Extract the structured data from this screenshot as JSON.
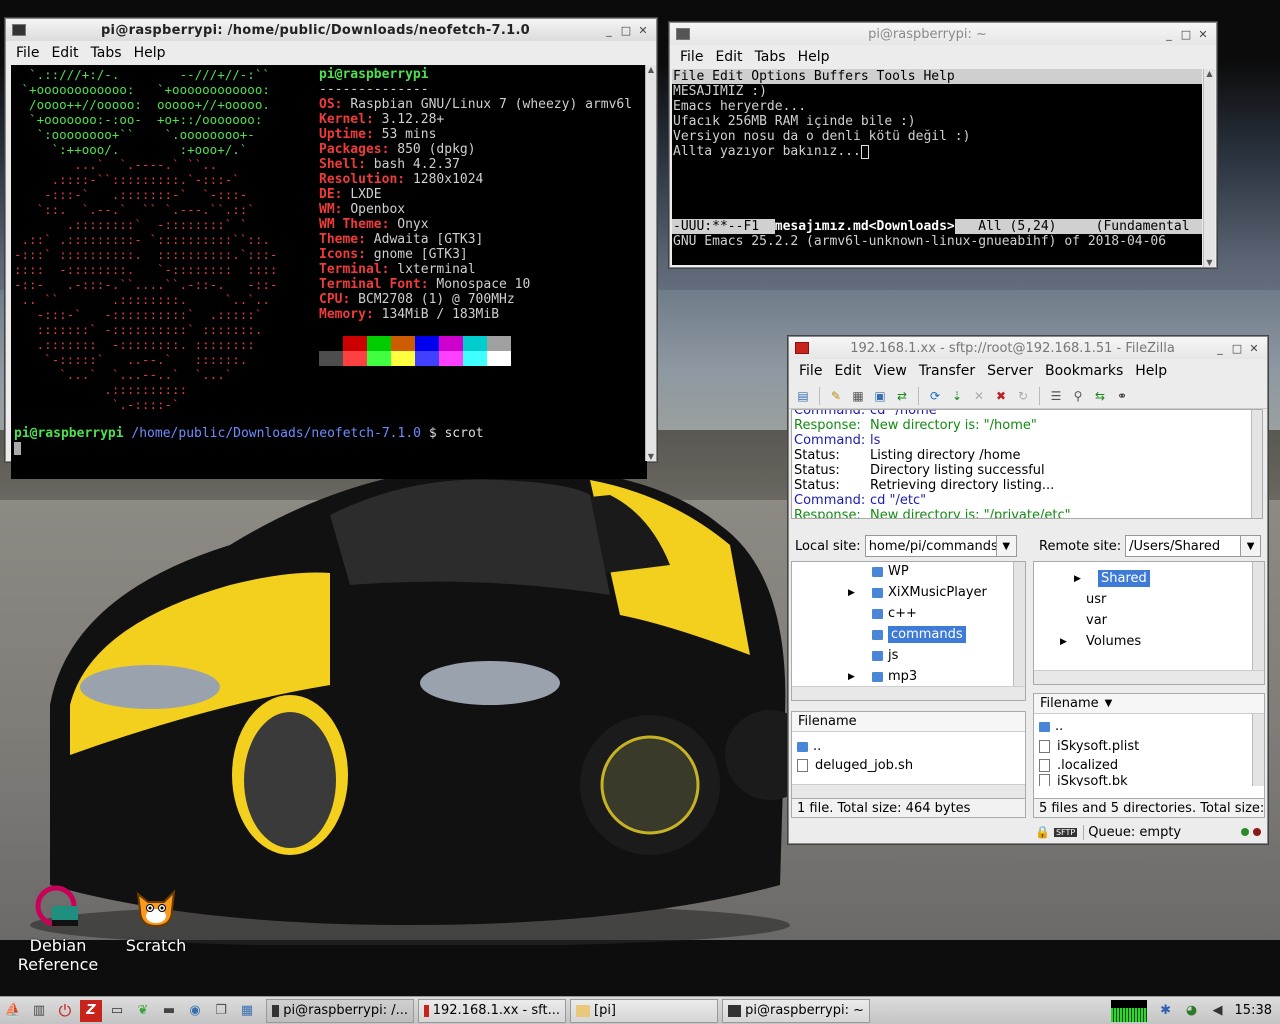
{
  "terminal1": {
    "title": "pi@raspberrypi: /home/public/Downloads/neofetch-7.1.0",
    "menu": [
      "File",
      "Edit",
      "Tabs",
      "Help"
    ],
    "host": "pi@raspberrypi",
    "separator": "--------------",
    "info": [
      {
        "k": "OS",
        "v": "Raspbian GNU/Linux 7 (wheezy) armv6l"
      },
      {
        "k": "Kernel",
        "v": "3.12.28+"
      },
      {
        "k": "Uptime",
        "v": "53 mins"
      },
      {
        "k": "Packages",
        "v": "850 (dpkg)"
      },
      {
        "k": "Shell",
        "v": "bash 4.2.37"
      },
      {
        "k": "Resolution",
        "v": "1280x1024"
      },
      {
        "k": "DE",
        "v": "LXDE"
      },
      {
        "k": "WM",
        "v": "Openbox"
      },
      {
        "k": "WM Theme",
        "v": "Onyx"
      },
      {
        "k": "Theme",
        "v": "Adwaita [GTK3]"
      },
      {
        "k": "Icons",
        "v": "gnome [GTK3]"
      },
      {
        "k": "Terminal",
        "v": "lxterminal"
      },
      {
        "k": "Terminal Font",
        "v": "Monospace 10"
      },
      {
        "k": "CPU",
        "v": "BCM2708 (1) @ 700MHz"
      },
      {
        "k": "Memory",
        "v": "134MiB / 183MiB"
      }
    ],
    "palette_top": [
      "#000000",
      "#cd0000",
      "#00cd00",
      "#cd5c00",
      "#0000ee",
      "#cd00cd",
      "#00cdcd",
      "#a0a0a0"
    ],
    "palette_bottom": [
      "#4d4d4d",
      "#ff4040",
      "#40ff40",
      "#ffff40",
      "#4040ff",
      "#ff40ff",
      "#40ffff",
      "#ffffff"
    ],
    "prompt_user": "pi@raspberrypi",
    "prompt_path": "/home/public/Downloads/neofetch-7.1.0",
    "prompt_cmd": "$ scrot"
  },
  "terminal2": {
    "title": "pi@raspberrypi: ~",
    "menu": [
      "File",
      "Edit",
      "Tabs",
      "Help"
    ],
    "emacs_menu": "File Edit Options Buffers Tools Help",
    "lines": [
      "MESAJIMIZ :)",
      "Emacs heryerde...",
      "Ufacık 256MB RAM içinde bile :)",
      "Versiyon nosu da o denli kötü değil :)",
      "Allta yazıyor bakınız..."
    ],
    "modeline_left": "-UUU:**--F1  ",
    "modeline_buffer": "mesajımız.md<Downloads>",
    "modeline_right": "   All (5,24)     (Fundamental",
    "minibuffer": "GNU Emacs 25.2.2 (armv6l-unknown-linux-gnueabihf) of 2018-04-06"
  },
  "filezilla": {
    "title": "192.168.1.xx - sftp://root@192.168.1.51 - FileZilla",
    "menu": [
      "File",
      "Edit",
      "View",
      "Transfer",
      "Server",
      "Bookmarks",
      "Help"
    ],
    "log": [
      {
        "label": "Command:",
        "text": "cd \"/home\"",
        "kind": "cm"
      },
      {
        "label": "Response:",
        "text": "New directory is: \"/home\"",
        "kind": "rs"
      },
      {
        "label": "Command:",
        "text": "ls",
        "kind": "cm"
      },
      {
        "label": "Status:",
        "text": "Listing directory /home",
        "kind": "st"
      },
      {
        "label": "Status:",
        "text": "Directory listing successful",
        "kind": "st"
      },
      {
        "label": "Status:",
        "text": "Retrieving directory listing...",
        "kind": "st"
      },
      {
        "label": "Command:",
        "text": "cd \"/etc\"",
        "kind": "cm"
      },
      {
        "label": "Response:",
        "text": "New directory is: \"/private/etc\"",
        "kind": "rs"
      }
    ],
    "local_label": "Local site:",
    "local_path": "home/pi/commands/",
    "remote_label": "Remote site:",
    "remote_path": "/Users/Shared",
    "local_tree": [
      "WP",
      "XiXMusicPlayer",
      "c++",
      "commands",
      "js",
      "mp3"
    ],
    "remote_tree": [
      "Shared",
      "usr",
      "var",
      "Volumes"
    ],
    "filename_header": "Filename",
    "local_files": [
      "..",
      "deluged_job.sh"
    ],
    "remote_files": [
      "..",
      "iSkysoft.plist",
      ".localized",
      "iSkysoft.bk"
    ],
    "local_status": "1 file. Total size: 464 bytes",
    "remote_status": "5 files and 5 directories. Total size:",
    "queue": "Queue: empty"
  },
  "desktop_icons": [
    {
      "label1": "Debian",
      "label2": "Reference"
    },
    {
      "label1": "Scratch",
      "label2": ""
    }
  ],
  "taskbar": {
    "tasks": [
      "pi@raspberrypi: /...",
      "192.168.1.xx - sft...",
      "[pi]",
      "pi@raspberrypi: ~"
    ],
    "clock": "15:38"
  }
}
